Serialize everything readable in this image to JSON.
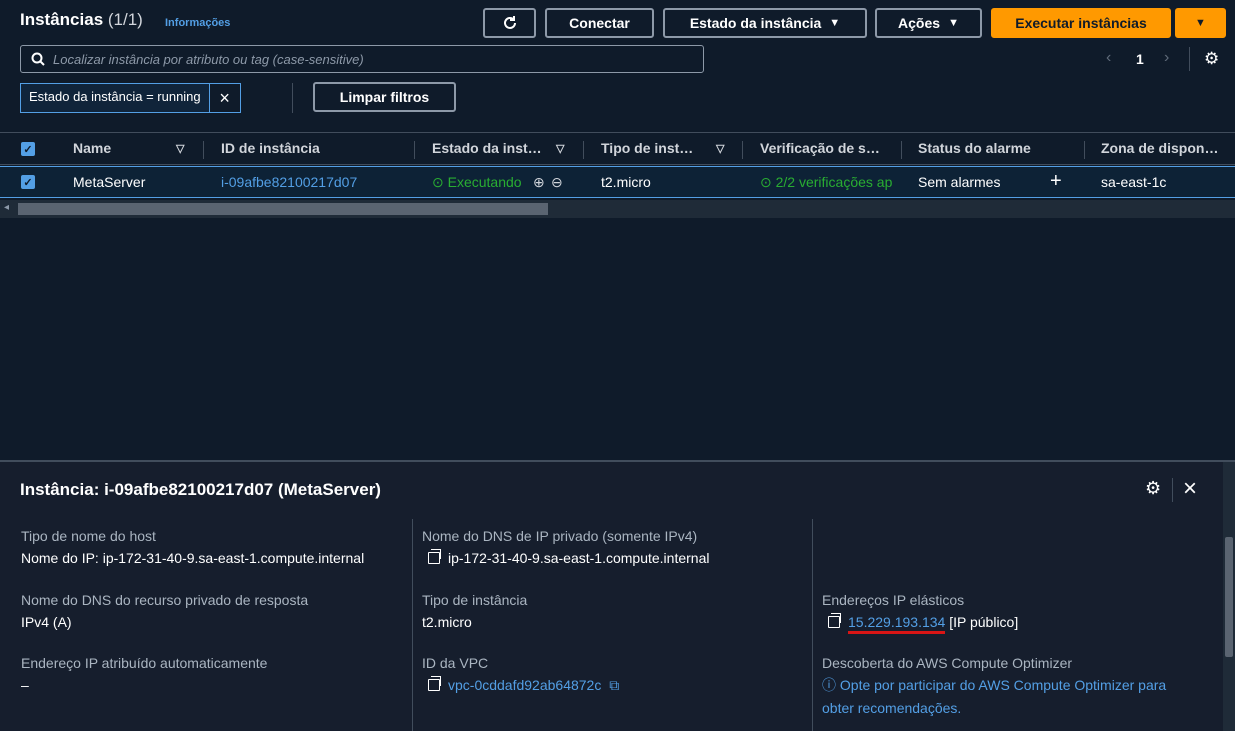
{
  "header": {
    "title": "Instâncias",
    "count": "(1/1)",
    "info_link": "Informações"
  },
  "toolbar": {
    "refresh_icon": "refresh-icon",
    "connect_label": "Conectar",
    "instance_state_label": "Estado da instância",
    "actions_label": "Ações",
    "launch_label": "Executar instâncias"
  },
  "search": {
    "placeholder": "Localizar instância por atributo ou tag (case-sensitive)"
  },
  "pagination": {
    "page": "1"
  },
  "filter": {
    "token": "Estado da instância = running",
    "clear_label": "Limpar filtros"
  },
  "table": {
    "columns": [
      "Name",
      "ID de instância",
      "Estado da inst…",
      "Tipo de inst…",
      "Verificação de s…",
      "Status do alarme",
      "Zona de dispon…"
    ],
    "rows": [
      {
        "name": "MetaServer",
        "instance_id": "i-09afbe82100217d07",
        "state": "Executando",
        "type": "t2.micro",
        "status_check": "2/2 verificações ap",
        "alarm": "Sem alarmes",
        "zone": "sa-east-1c"
      }
    ]
  },
  "details": {
    "title": "Instância: i-09afbe82100217d07 (MetaServer)",
    "fields": {
      "hostname_type_label": "Tipo de nome do host",
      "hostname_type_value": "Nome do IP: ip-172-31-40-9.sa-east-1.compute.internal",
      "private_dns_label": "Nome do DNS de IP privado (somente IPv4)",
      "private_dns_value": "ip-172-31-40-9.sa-east-1.compute.internal",
      "resource_dns_label": "Nome do DNS do recurso privado de resposta",
      "resource_dns_value": "IPv4 (A)",
      "instance_type_label": "Tipo de instância",
      "instance_type_value": "t2.micro",
      "elastic_ip_label": "Endereços IP elásticos",
      "elastic_ip_value": "15.229.193.134",
      "elastic_ip_suffix": "[IP público]",
      "auto_ip_label": "Endereço IP atribuído automaticamente",
      "auto_ip_value": "–",
      "vpc_label": "ID da VPC",
      "vpc_value": "vpc-0cddafd92ab64872c",
      "optimizer_label": "Descoberta do AWS Compute Optimizer",
      "optimizer_line1": "Opte por participar do AWS Compute Optimizer para",
      "optimizer_line2": "obter recomendações."
    }
  },
  "colors": {
    "accent": "#ff9900",
    "link": "#539fe5",
    "success": "#29ad32",
    "background": "#0f1b2a",
    "underline": "#d91515"
  }
}
